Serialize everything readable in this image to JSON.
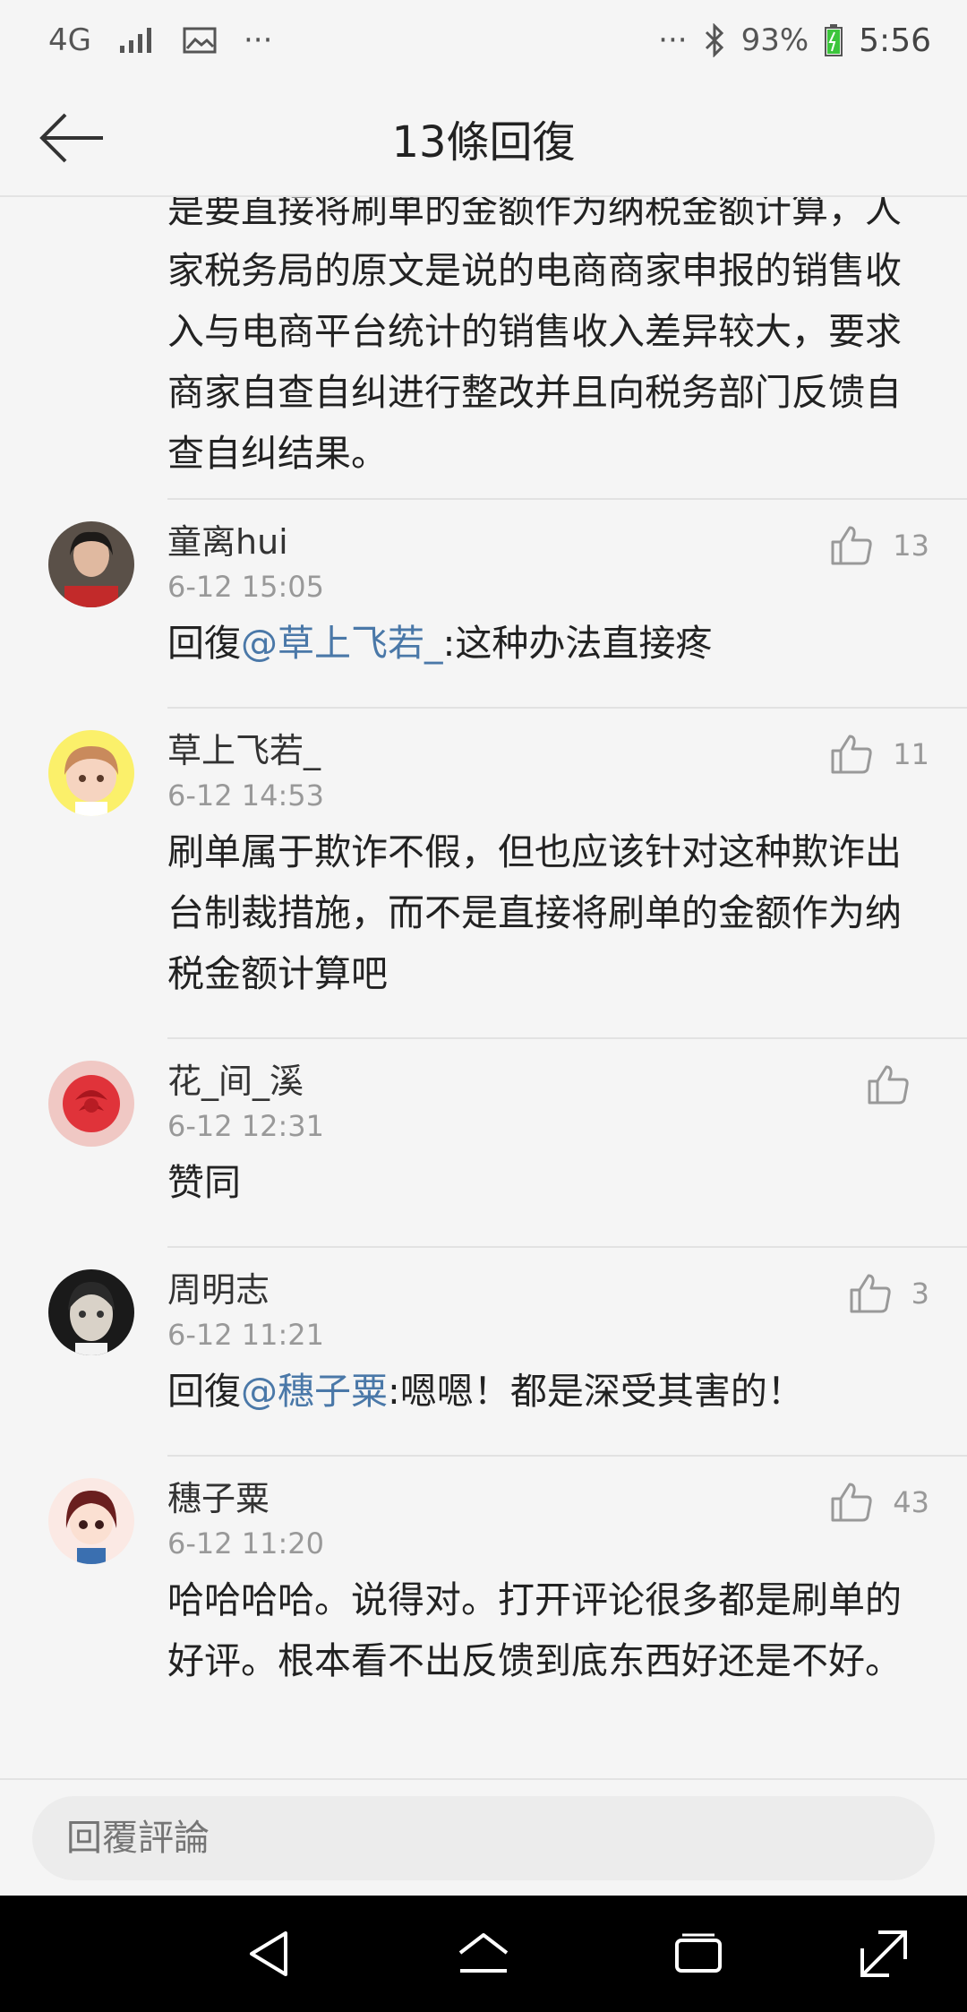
{
  "status_bar": {
    "network": "4G",
    "more_left": "···",
    "more_right": "···",
    "battery": "93%",
    "time": "5:56"
  },
  "header": {
    "title": "13條回復"
  },
  "top_text": "是要直接将刷单的金额作为纳税金额计算，人家税务局的原文是说的电商商家申报的销售收入与电商平台统计的销售收入差异较大，要求商家自查自纠进行整改并且向税务部门反馈自查自纠结果。",
  "comments": [
    {
      "name": "童离hui",
      "time": "6-12 15:05",
      "likes": "13",
      "reply_prefix": "回復",
      "mention": "@草上飞若_",
      "text": ":这种办法直接疼"
    },
    {
      "name": "草上飞若_",
      "time": "6-12 14:53",
      "likes": "11",
      "text": "刷单属于欺诈不假，但也应该针对这种欺诈出台制裁措施，而不是直接将刷单的金额作为纳税金额计算吧"
    },
    {
      "name": "花_间_溪",
      "time": "6-12 12:31",
      "likes": "",
      "text": "赞同"
    },
    {
      "name": "周明志",
      "time": "6-12 11:21",
      "likes": "3",
      "reply_prefix": "回復",
      "mention": "@穗子粟",
      "text": ":嗯嗯！都是深受其害的！"
    },
    {
      "name": "穗子粟",
      "time": "6-12 11:20",
      "likes": "43",
      "text": "哈哈哈哈。说得对。打开评论很多都是刷单的好评。根本看不出反馈到底东西好还是不好。"
    }
  ],
  "reply_bar": {
    "placeholder": "回覆評論"
  },
  "colors": {
    "background": "#f5f5f5",
    "mention": "#4a78a8",
    "muted": "#999999",
    "battery": "#3cc53c"
  },
  "icons": {
    "back": "arrow-left-icon",
    "like": "thumbs-up-icon",
    "nav_back": "triangle-back-icon",
    "nav_home": "home-icon",
    "nav_recent": "recent-apps-icon",
    "nav_expand": "expand-icon"
  }
}
